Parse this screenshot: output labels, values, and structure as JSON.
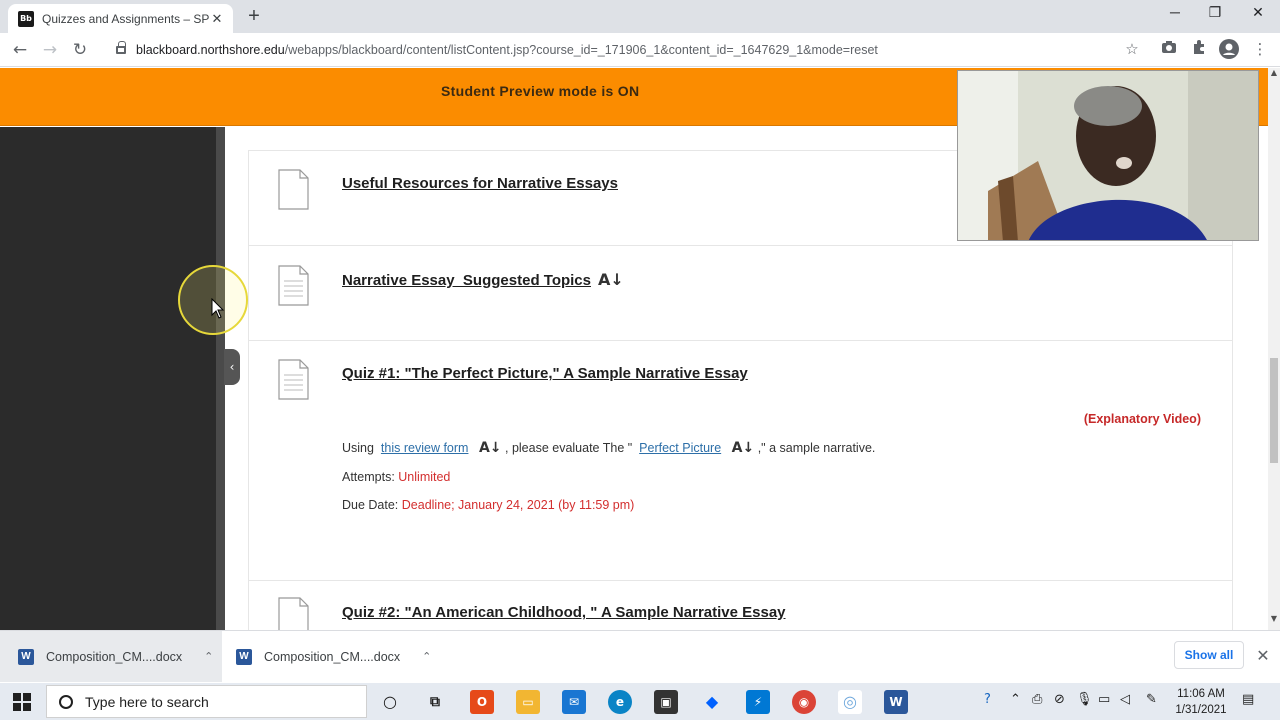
{
  "browser": {
    "tab_title": "Quizzes and Assignments – SPRI",
    "tab_favicon": "Bb",
    "tab_close": "✕",
    "new_tab": "+",
    "url_host": "blackboard.northshore.edu",
    "url_path": "/webapps/blackboard/content/listContent.jsp?course_id=_171906_1&content_id=_1647629_1&mode=reset",
    "win_minimize": "─",
    "win_restore": "❐",
    "win_close": "✕",
    "back": "←",
    "forward": "→",
    "reload": "↻"
  },
  "banner": {
    "text": "Student Preview mode is ON"
  },
  "items": [
    {
      "title": "Useful Resources for Narrative Essays"
    },
    {
      "title": "Narrative Essay_Suggested Topics",
      "icon": "A↓"
    },
    {
      "title": "Quiz #1: \"The Perfect Picture,\" A Sample Narrative Essay",
      "explanatory": "(Explanatory Video)",
      "using": "Using",
      "review_link": "this review form",
      "please": ", please evaluate The \"",
      "perfect_link": "Perfect Picture",
      "tail": ",\" a sample narrative.",
      "attempts_label": "Attempts:",
      "attempts_value": "Unlimited",
      "due_label": "Due Date:",
      "due_value": "Deadline; January 24, 2021 (by 11:59 pm)"
    },
    {
      "title": "Quiz #2: \"An American Childhood, \" A Sample Narrative Essay"
    }
  ],
  "collapse_glyph": "‹",
  "downloads": [
    {
      "name": "Composition_CM....docx"
    },
    {
      "name": "Composition_CM....docx"
    }
  ],
  "downloads_show_all": "Show all",
  "downloads_close": "✕",
  "taskbar": {
    "search_placeholder": "Type here to search",
    "time": "11:06 AM",
    "date": "1/31/2021"
  },
  "colors": {
    "banner": "#fb8c00",
    "link": "#2d6fa8",
    "alert_red": "#d32f2f"
  }
}
